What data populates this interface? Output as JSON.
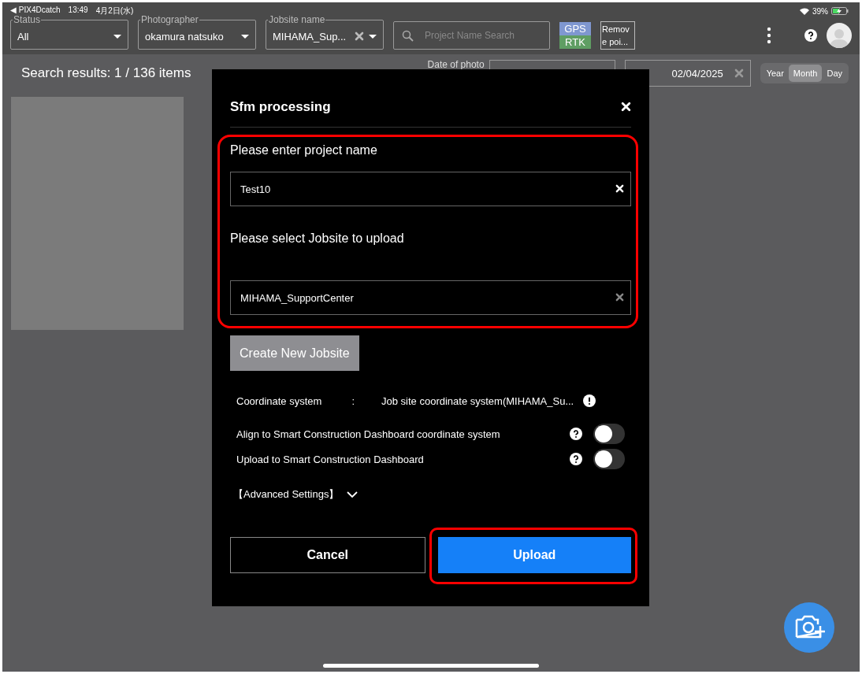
{
  "status_bar": {
    "back_app": "◀ PIX4Dcatch",
    "time": "13:49",
    "date": "4月2日(水)",
    "battery": "39%"
  },
  "filters": [
    {
      "label": "Status",
      "value": "All",
      "clearable": false
    },
    {
      "label": "Photographer",
      "value": "okamura natsuko",
      "clearable": false
    },
    {
      "label": "Jobsite name",
      "value": "MIHAMA_Sup...",
      "clearable": true
    }
  ],
  "search": {
    "placeholder": "Project Name Search"
  },
  "gps_badge": {
    "top": "GPS",
    "bottom": "RTK"
  },
  "remove_button": "Remov e poi...",
  "results": "Search results: 1 / 136 items",
  "date_filter": {
    "label": "Date of photo",
    "to": "02/04/2025"
  },
  "period_tabs": [
    {
      "label": "Year",
      "selected": false
    },
    {
      "label": "Month",
      "selected": true
    },
    {
      "label": "Day",
      "selected": false
    }
  ],
  "dialog": {
    "title": "Sfm processing",
    "project_label": "Please enter project name",
    "project_value": "Test10",
    "jobsite_label": "Please select Jobsite to upload",
    "jobsite_value": "MIHAMA_SupportCenter",
    "create_button": "Create New Jobsite",
    "coordinate": {
      "label": "Coordinate system",
      "sep": ":",
      "value": "Job site coordinate system(MIHAMA_Su..."
    },
    "toggles": [
      {
        "label": "Align to Smart Construction Dashboard coordinate system",
        "on": false
      },
      {
        "label": "Upload to Smart Construction Dashboard",
        "on": false
      }
    ],
    "advanced": {
      "label": "【Advanced Settings】",
      "expanded": false
    },
    "cancel": "Cancel",
    "upload": "Upload"
  }
}
